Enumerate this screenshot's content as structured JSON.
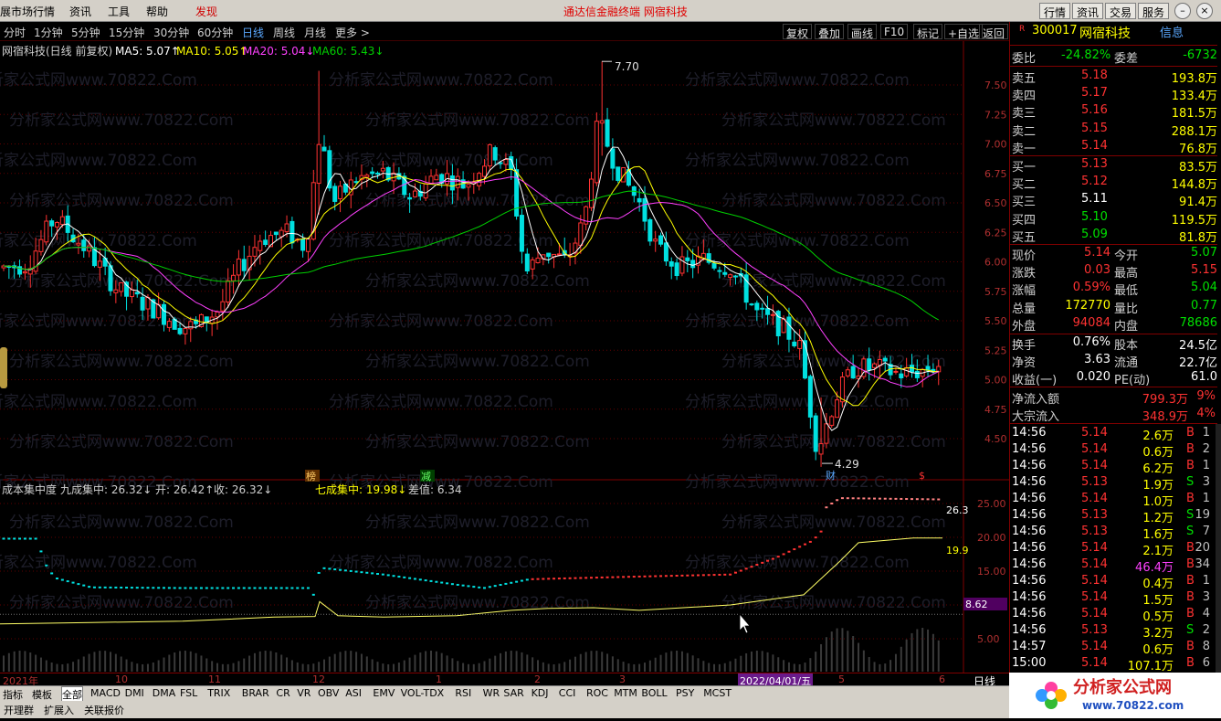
{
  "menu": {
    "items": [
      "展市场行情",
      "资讯",
      "工具",
      "帮助",
      "发现"
    ],
    "center_title": "通达信金融终端    网宿科技",
    "right_buttons": [
      "行情",
      "资讯",
      "交易",
      "服务"
    ]
  },
  "periods": {
    "items": [
      "分时",
      "1分钟",
      "5分钟",
      "15分钟",
      "30分钟",
      "60分钟",
      "日线",
      "周线",
      "月线",
      "更多 >"
    ],
    "active": "日线",
    "right_buttons": [
      "复权",
      "叠加",
      "画线",
      "F10",
      "标记",
      "+自选",
      "返回"
    ]
  },
  "main_chart": {
    "title": "网宿科技(日线 前复权)",
    "ma5": "MA5: 5.07↑",
    "ma10": "MA10: 5.05↑",
    "ma20": "MA20: 5.04↓",
    "ma60": "MA60: 5.43↓",
    "high_label": "7.70",
    "low_label": "4.29",
    "y_ticks": [
      "7.50",
      "7.25",
      "7.00",
      "6.75",
      "6.50",
      "6.25",
      "6.00",
      "5.75",
      "5.50",
      "5.25",
      "5.00",
      "4.75",
      "4.50"
    ],
    "markers": {
      "bang": "榜",
      "jian": "减",
      "cai": "财",
      "s": "$"
    },
    "colors": {
      "up": "#ff3232",
      "down": "#00e0e0",
      "ma5": "#ffffff",
      "ma10": "#ffff00",
      "ma20": "#ff40ff",
      "ma60": "#00d000",
      "grid": "#600000"
    }
  },
  "sub_chart": {
    "title": "成本集中度",
    "nine": "九成集中: 26.32↓",
    "open": "开: 26.42↑",
    "close": "收: 26.32↓",
    "seven": "七成集中: 19.98↓",
    "diff": "差值: 6.34",
    "y_ticks": [
      "25.00",
      "20.00",
      "15.00",
      "10.00",
      "5.00"
    ],
    "right_labels": {
      "nine": "26.3",
      "seven": "19.9",
      "cursor": "8.62"
    }
  },
  "time_axis": {
    "labels": [
      "2021年",
      "10",
      "11",
      "12",
      "1",
      "2",
      "3",
      "2022/04/01/五",
      "5",
      "6"
    ],
    "right": "日线"
  },
  "indicator_tabs": [
    "指标",
    "模板",
    "全部",
    "MACD",
    "DMI",
    "DMA",
    "FSL",
    "TRIX",
    "BRAR",
    "CR",
    "VR",
    "OBV",
    "ASI",
    "EMV",
    "VOL-TDX",
    "RSI",
    "WR",
    "SAR",
    "KDJ",
    "CCI",
    "ROC",
    "MTM",
    "BOLL",
    "PSY",
    "MCST"
  ],
  "sub_tabs": [
    "开理群",
    "扩展入",
    "关联报价"
  ],
  "quote": {
    "code": "300017",
    "name": "网宿科技",
    "info": "信息",
    "webi": {
      "label": "委比",
      "value": "-24.82%",
      "label2": "委差",
      "value2": "-6732"
    },
    "sell": [
      {
        "label": "卖五",
        "price": "5.18",
        "vol": "193.8万"
      },
      {
        "label": "卖四",
        "price": "5.17",
        "vol": "133.4万"
      },
      {
        "label": "卖三",
        "price": "5.16",
        "vol": "181.5万"
      },
      {
        "label": "卖二",
        "price": "5.15",
        "vol": "288.1万"
      },
      {
        "label": "卖一",
        "price": "5.14",
        "vol": "76.8万"
      }
    ],
    "buy": [
      {
        "label": "买一",
        "price": "5.13",
        "vol": "83.5万"
      },
      {
        "label": "买二",
        "price": "5.12",
        "vol": "144.8万"
      },
      {
        "label": "买三",
        "price": "5.11",
        "vol": "91.4万"
      },
      {
        "label": "买四",
        "price": "5.10",
        "vol": "119.5万"
      },
      {
        "label": "买五",
        "price": "5.09",
        "vol": "81.8万"
      }
    ],
    "stats": [
      {
        "l1": "现价",
        "v1": "5.14",
        "l2": "今开",
        "v2": "5.07"
      },
      {
        "l1": "涨跌",
        "v1": "0.03",
        "l2": "最高",
        "v2": "5.15"
      },
      {
        "l1": "涨幅",
        "v1": "0.59%",
        "l2": "最低",
        "v2": "5.04"
      },
      {
        "l1": "总量",
        "v1": "172770",
        "l2": "量比",
        "v2": "0.77"
      },
      {
        "l1": "外盘",
        "v1": "94084",
        "l2": "内盘",
        "v2": "78686"
      }
    ],
    "stats2": [
      {
        "l1": "换手",
        "v1": "0.76%",
        "l2": "股本",
        "v2": "24.5亿"
      },
      {
        "l1": "净资",
        "v1": "3.63",
        "l2": "流通",
        "v2": "22.7亿"
      },
      {
        "l1": "收益(一)",
        "v1": "0.020",
        "l2": "PE(动)",
        "v2": "61.0"
      }
    ],
    "flow": [
      {
        "label": "净流入额",
        "value": "799.3万",
        "pct": "9%"
      },
      {
        "label": "大宗流入",
        "value": "348.9万",
        "pct": "4%"
      }
    ],
    "ticks": [
      {
        "t": "14:56",
        "p": "5.14",
        "v": "2.6万",
        "bs": "B",
        "n": "1"
      },
      {
        "t": "14:56",
        "p": "5.14",
        "v": "0.6万",
        "bs": "B",
        "n": "2"
      },
      {
        "t": "14:56",
        "p": "5.14",
        "v": "6.2万",
        "bs": "B",
        "n": "1"
      },
      {
        "t": "14:56",
        "p": "5.13",
        "v": "1.9万",
        "bs": "S",
        "n": "3"
      },
      {
        "t": "14:56",
        "p": "5.14",
        "v": "1.0万",
        "bs": "B",
        "n": "1"
      },
      {
        "t": "14:56",
        "p": "5.13",
        "v": "1.2万",
        "bs": "S",
        "n": "19"
      },
      {
        "t": "14:56",
        "p": "5.13",
        "v": "1.6万",
        "bs": "S",
        "n": "7"
      },
      {
        "t": "14:56",
        "p": "5.14",
        "v": "2.1万",
        "bs": "B",
        "n": "20"
      },
      {
        "t": "14:56",
        "p": "5.14",
        "v": "46.4万",
        "bs": "B",
        "n": "34"
      },
      {
        "t": "14:56",
        "p": "5.14",
        "v": "0.4万",
        "bs": "B",
        "n": "1"
      },
      {
        "t": "14:56",
        "p": "5.14",
        "v": "1.5万",
        "bs": "B",
        "n": "3"
      },
      {
        "t": "14:56",
        "p": "5.14",
        "v": "0.5万",
        "bs": "B",
        "n": "4"
      },
      {
        "t": "14:56",
        "p": "5.13",
        "v": "3.2万",
        "bs": "S",
        "n": "2"
      },
      {
        "t": "14:57",
        "p": "5.14",
        "v": "0.6万",
        "bs": "B",
        "n": "8"
      },
      {
        "t": "15:00",
        "p": "5.14",
        "v": "107.1万",
        "bs": "B",
        "n": "6"
      }
    ]
  },
  "logo": {
    "text1": "分析家公式网",
    "text2": "www.70822.com"
  },
  "watermark": "分析家公式网www.70822.Com"
}
